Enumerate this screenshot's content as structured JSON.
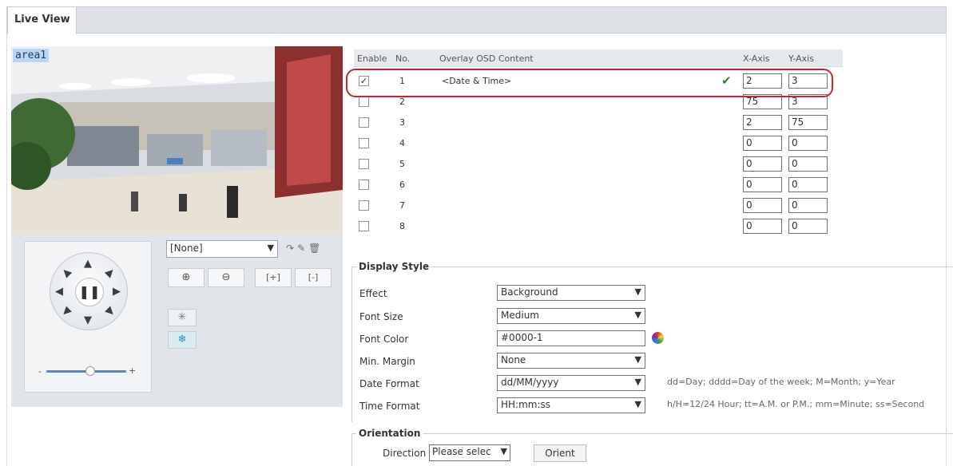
{
  "tabs": [
    {
      "label": "Live View"
    }
  ],
  "video": {
    "area_label": "area1"
  },
  "ptz": {
    "preset_value": "[None]",
    "zoom_in": "⊕",
    "zoom_out": "⊖",
    "focus_near": "[+]",
    "focus_far": "[-]"
  },
  "osd": {
    "headers": {
      "enable": "Enable",
      "no": "No.",
      "content": "Overlay OSD Content",
      "x": "X-Axis",
      "y": "Y-Axis"
    },
    "rows": [
      {
        "no": "1",
        "enabled": true,
        "content": "<Date & Time>",
        "x": "2",
        "y": "3"
      },
      {
        "no": "2",
        "enabled": false,
        "content": "",
        "x": "75",
        "y": "3"
      },
      {
        "no": "3",
        "enabled": false,
        "content": "",
        "x": "2",
        "y": "75"
      },
      {
        "no": "4",
        "enabled": false,
        "content": "",
        "x": "0",
        "y": "0"
      },
      {
        "no": "5",
        "enabled": false,
        "content": "",
        "x": "0",
        "y": "0"
      },
      {
        "no": "6",
        "enabled": false,
        "content": "",
        "x": "0",
        "y": "0"
      },
      {
        "no": "7",
        "enabled": false,
        "content": "",
        "x": "0",
        "y": "0"
      },
      {
        "no": "8",
        "enabled": false,
        "content": "",
        "x": "0",
        "y": "0"
      }
    ]
  },
  "display_style": {
    "legend": "Display Style",
    "effect": {
      "label": "Effect",
      "value": "Background"
    },
    "font_size": {
      "label": "Font Size",
      "value": "Medium"
    },
    "font_color": {
      "label": "Font Color",
      "value": "#0000-1"
    },
    "min_margin": {
      "label": "Min. Margin",
      "value": "None"
    },
    "date_format": {
      "label": "Date Format",
      "value": "dd/MM/yyyy",
      "hint": "dd=Day; dddd=Day of the week; M=Month; y=Year"
    },
    "time_format": {
      "label": "Time Format",
      "value": "HH:mm:ss",
      "hint": "h/H=12/24 Hour; tt=A.M. or P.M.; mm=Minute; ss=Second"
    }
  },
  "orientation": {
    "legend": "Orientation",
    "direction_label": "Direction",
    "direction_value": "Please selec",
    "orient_button": "Orient"
  }
}
